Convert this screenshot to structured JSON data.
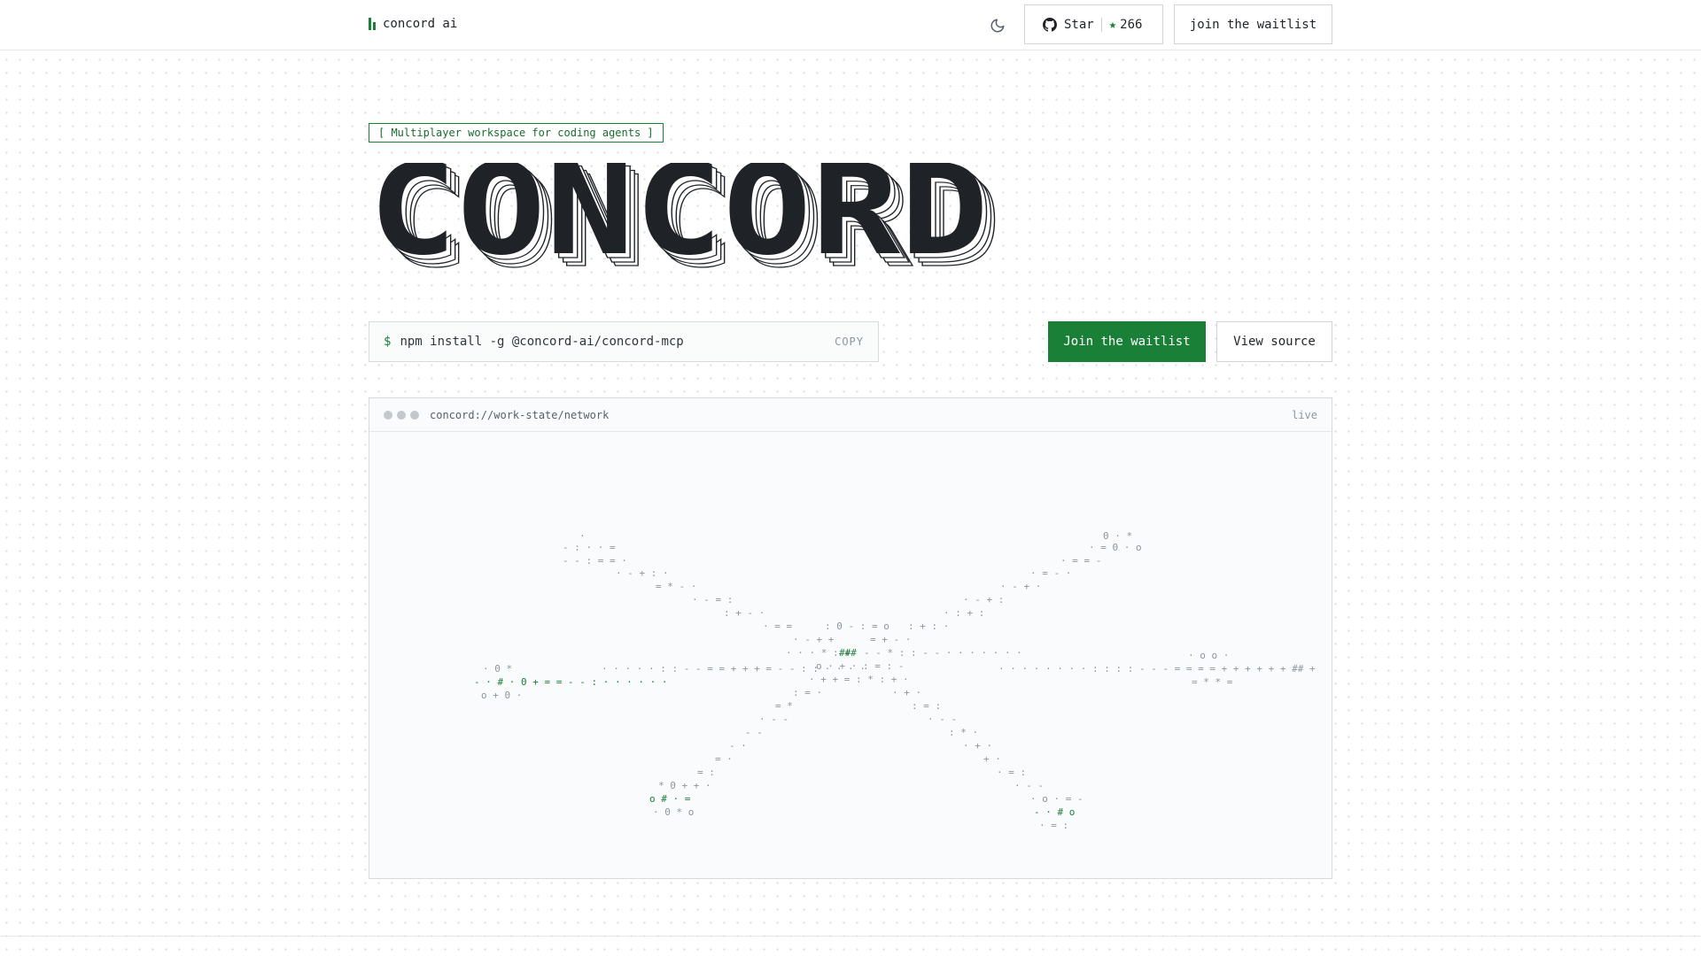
{
  "header": {
    "brand": "concord ai",
    "star_label": "Star",
    "star_count": "266",
    "waitlist_label": "join the waitlist",
    "icons": [
      "brand-mark-icon",
      "moon-icon",
      "github-icon",
      "star-icon"
    ]
  },
  "hero": {
    "tagline": "[ Multiplayer workspace for coding agents ]",
    "title": "CONCORD",
    "install_prompt": "$",
    "install_command": "npm install -g @concord-ai/concord-mcp",
    "copy_label": "COPY",
    "primary_cta": "Join the waitlist",
    "secondary_cta": "View source"
  },
  "panel": {
    "url": "concord://work-state/network",
    "status": "live",
    "ascii_lines": [
      ".",
      "- : · · =",
      "- -  : = = ·",
      "· - + : ·",
      "= * - ·",
      "· - = :",
      ": + - ·",
      "· = =",
      "· - + +",
      "· · · * : +",
      "###",
      "- - * : : - - · · · · · · ·",
      ": 0 - : = o",
      "= + - ·",
      ": + : ·",
      "· : + :",
      "· - + :",
      "· - + ·",
      "· = - ·",
      "· = = -",
      "0 · *",
      "· = 0 · o",
      "o · + ·   : = : -",
      "· + + =   : * : + ·",
      ": = ·",
      "= *",
      "· - -",
      "- -",
      "- ·",
      "= ·",
      "= :",
      "* 0 + + ·",
      "o  #  · =",
      "· 0 * o",
      "· + ·",
      ": = :",
      "· - -",
      ": * ·",
      "· + ·",
      "+ ·",
      "· = :",
      "· - -",
      "· o · = -",
      "- · #  o",
      "· = :",
      "· 0 *",
      "- · # · 0 + = = - - : · · · · · ·",
      "o + 0 ·",
      "· · · · · : : - - = = + + + = - - : : · · · ·",
      "· · · · · · · · : : : : - - - = = = = + + + + + + ## +",
      "· o o ·",
      "= * * ="
    ]
  },
  "colors": {
    "accent": "#1a7f37",
    "text": "#1f2328",
    "muted": "#8c959f",
    "border": "#d0d4d8"
  }
}
